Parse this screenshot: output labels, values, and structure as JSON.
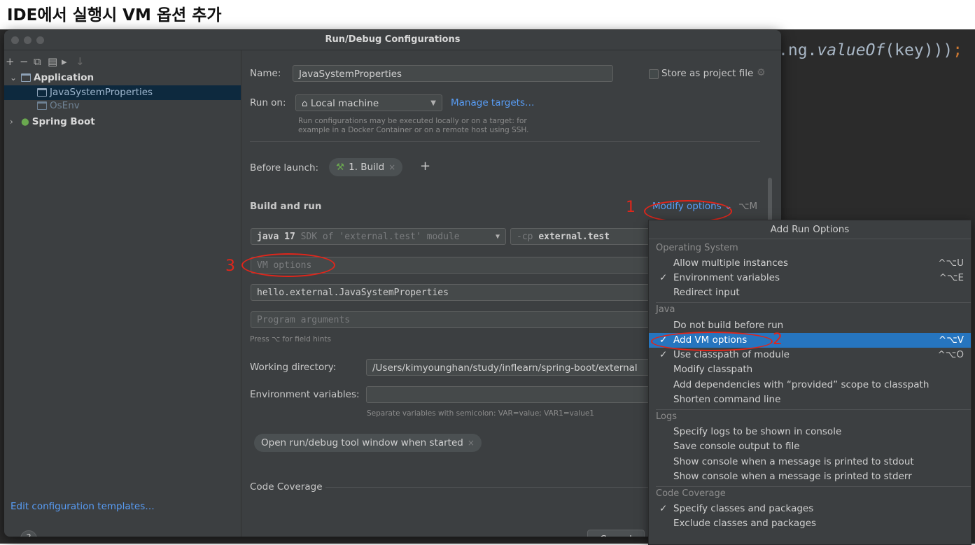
{
  "heading": "IDE에서 실행시 VM 옵션 추가",
  "code_line": {
    "prefix": ".ng.",
    "method": "valueOf",
    "suffix": "(key)))",
    "semicolon": ";"
  },
  "dialog": {
    "title": "Run/Debug Configurations",
    "toolbar": [
      "+",
      "−",
      "⧉",
      "▤",
      "▸",
      "↓"
    ],
    "tree": {
      "application": "Application",
      "items": [
        "JavaSystemProperties",
        "OsEnv"
      ],
      "spring_boot": "Spring Boot"
    },
    "edit_templates": "Edit configuration templates…",
    "help": "?",
    "name_label": "Name:",
    "name_value": "JavaSystemProperties",
    "store_label": "Store as project file",
    "run_on_label": "Run on:",
    "run_on_value": "Local machine",
    "manage_targets": "Manage targets…",
    "run_hint_1": "Run configurations may be executed locally or on a target: for",
    "run_hint_2": "example in a Docker Container or on a remote host using SSH.",
    "before_launch_label": "Before launch:",
    "build_chip": "1. Build",
    "build_and_run": "Build and run",
    "modify_options": "Modify options",
    "modify_shortcut": "⌥M",
    "sdk_java": "java 17",
    "sdk_rest": "SDK of 'external.test' module",
    "cp_flag": "-cp",
    "cp_value": "external.test",
    "vm_options_placeholder": "VM options",
    "main_class": "hello.external.JavaSystemProperties",
    "program_args_placeholder": "Program arguments",
    "field_hint": "Press ⌥ for field hints",
    "working_dir_label": "Working directory:",
    "working_dir_value": "/Users/kimyounghan/study/inflearn/spring-boot/external",
    "env_label": "Environment variables:",
    "env_hint": "Separate variables with semicolon: VAR=value; VAR1=value1",
    "open_tool_window": "Open run/debug tool window when started",
    "code_coverage": "Code Coverage",
    "cancel": "Cancel"
  },
  "annotations": {
    "one": "1",
    "two": "2",
    "three": "3"
  },
  "popup": {
    "title": "Add Run Options",
    "groups": [
      {
        "name": "Operating System",
        "items": [
          {
            "label": "Allow multiple instances",
            "checked": false,
            "shortcut": "^⌥U"
          },
          {
            "label": "Environment variables",
            "checked": true,
            "shortcut": "^⌥E"
          },
          {
            "label": "Redirect input",
            "checked": false,
            "shortcut": ""
          }
        ]
      },
      {
        "name": "Java",
        "items": [
          {
            "label": "Do not build before run",
            "checked": false,
            "shortcut": ""
          },
          {
            "label": "Add VM options",
            "checked": true,
            "shortcut": "^⌥V"
          },
          {
            "label": "Use classpath of module",
            "checked": true,
            "shortcut": "^⌥O"
          },
          {
            "label": "Modify classpath",
            "checked": false,
            "shortcut": ""
          },
          {
            "label": "Add dependencies with “provided” scope to classpath",
            "checked": false,
            "shortcut": ""
          },
          {
            "label": "Shorten command line",
            "checked": false,
            "shortcut": ""
          }
        ]
      },
      {
        "name": "Logs",
        "items": [
          {
            "label": "Specify logs to be shown in console",
            "checked": false,
            "shortcut": ""
          },
          {
            "label": "Save console output to file",
            "checked": false,
            "shortcut": ""
          },
          {
            "label": "Show console when a message is printed to stdout",
            "checked": false,
            "shortcut": ""
          },
          {
            "label": "Show console when a message is printed to stderr",
            "checked": false,
            "shortcut": ""
          }
        ]
      },
      {
        "name": "Code Coverage",
        "items": [
          {
            "label": "Specify classes and packages",
            "checked": true,
            "shortcut": ""
          },
          {
            "label": "Exclude classes and packages",
            "checked": false,
            "shortcut": ""
          }
        ]
      }
    ],
    "check_mark": "✓"
  }
}
